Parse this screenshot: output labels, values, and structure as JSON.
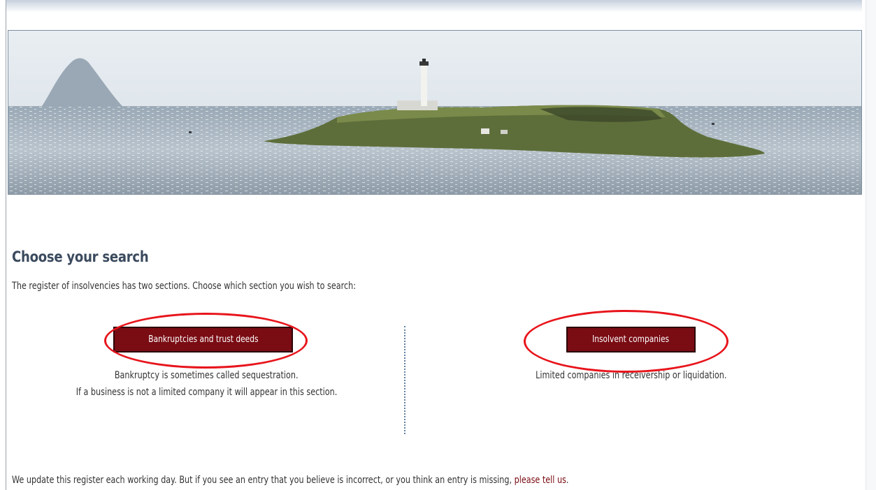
{
  "search": {
    "heading": "Choose your search",
    "intro": "The register of insolvencies has two sections. Choose which section you wish to search:",
    "bankruptcies": {
      "button_label": "Bankruptcies and trust deeds",
      "description_line1": "Bankruptcy is sometimes called sequestration.",
      "description_line2": "If a business is not a limited company it will appear in this section."
    },
    "companies": {
      "button_label": "Insolvent companies",
      "description": "Limited companies in receivership or liquidation."
    }
  },
  "footer": {
    "text": "We update this register each working day. But if you see an entry that you believe is incorrect, or you think an entry is missing, ",
    "link_text": "please tell us",
    "suffix": "."
  },
  "annotations": {
    "highlight_color": "#e8141b"
  },
  "colors": {
    "button_bg": "#7a0c14",
    "heading": "#3b4a5e",
    "link": "#7a0c14"
  }
}
